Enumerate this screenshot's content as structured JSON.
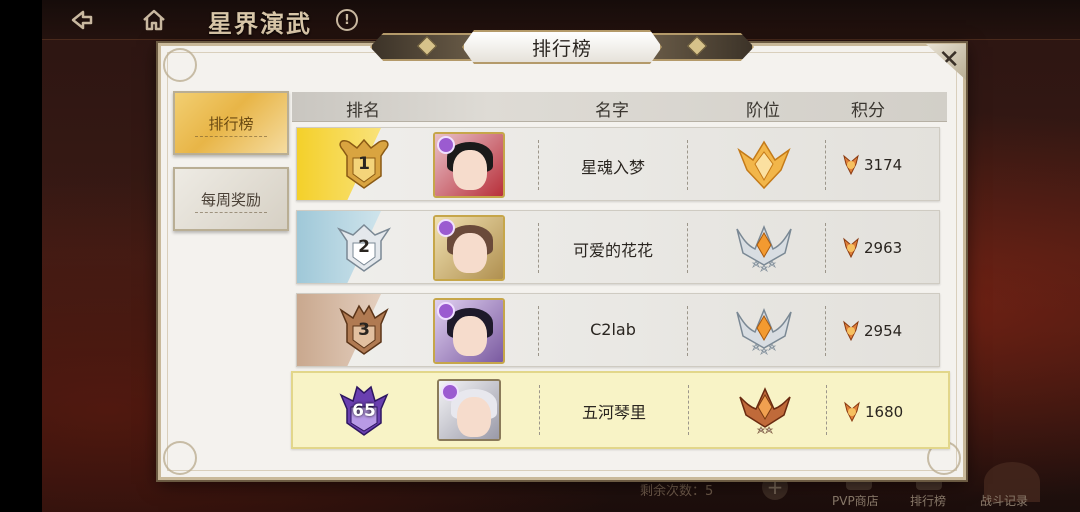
{
  "header": {
    "title": "星界演武",
    "help_symbol": "!"
  },
  "panel": {
    "title": "排行榜",
    "close_symbol": "✕"
  },
  "tabs": [
    {
      "label": "排行榜",
      "active": true
    },
    {
      "label": "每周奖励",
      "active": false
    }
  ],
  "table": {
    "columns": [
      "排名",
      "名字",
      "阶位",
      "积分"
    ],
    "rows": [
      {
        "rank": "1",
        "name": "星魂入梦",
        "score": "3174",
        "rank_color": "#f0c830",
        "tier": "gold"
      },
      {
        "rank": "2",
        "name": "可爱的花花",
        "score": "2963",
        "rank_color": "#9fc8d8",
        "tier": "silver"
      },
      {
        "rank": "3",
        "name": "C2lab",
        "score": "2954",
        "rank_color": "#c9a88e",
        "tier": "silver"
      },
      {
        "rank": "65",
        "name": "五河琴里",
        "score": "1680",
        "rank_color": "#7c4fc0",
        "tier": "bronze"
      }
    ]
  },
  "bottom": {
    "remaining": "剩余次数：5",
    "plus_symbol": "+",
    "pvp_shop": "PVP商店",
    "ranking": "排行榜",
    "battle_log": "战斗记录"
  }
}
